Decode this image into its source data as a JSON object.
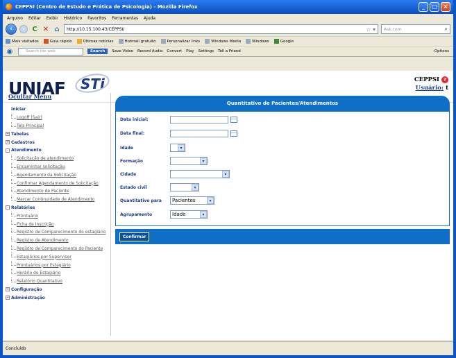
{
  "window": {
    "title": "CEPPSI (Centro de Estudo e Prática de Psicologia) - Mozilla Firefox"
  },
  "menubar": [
    "Arquivo",
    "Editar",
    "Exibir",
    "Histórico",
    "Favoritos",
    "Ferramentas",
    "Ajuda"
  ],
  "nav": {
    "url": "http://10.15.100.43/CEPPSI/",
    "search_placeholder": "Ask.com"
  },
  "bookmarks": [
    "Mais visitados",
    "Guia rápido",
    "Últimas notícias",
    "Hotmail gratuito",
    "Personalizar links",
    "Windows Media",
    "Windows",
    "Google"
  ],
  "toolbar2": {
    "search_placeholder": "Search the web",
    "search_button": "Search",
    "items": [
      "Save Video",
      "Record Audio",
      "Convert",
      "Play",
      "Settings",
      "Tell a Friend"
    ],
    "options": "Options"
  },
  "header": {
    "logo_main": "UNIAF",
    "logo_sti": "STi",
    "org": "CEPPSI",
    "user_label": "Usuário:",
    "user_value": "t"
  },
  "sidebar": {
    "title": "Ocultar Menu",
    "tree": [
      {
        "type": "group",
        "label": "Iniciar",
        "box": ""
      },
      {
        "type": "leaf",
        "label": "Logoff (Sair)"
      },
      {
        "type": "leaf",
        "label": "Tela Principal"
      },
      {
        "type": "group",
        "label": "Tabelas",
        "box": "+"
      },
      {
        "type": "group",
        "label": "Cadastros",
        "box": "+"
      },
      {
        "type": "group",
        "label": "Atendimento",
        "box": "-"
      },
      {
        "type": "leaf",
        "label": "Solicitação de atendimento"
      },
      {
        "type": "leaf",
        "label": "Encaminhar solicitação"
      },
      {
        "type": "leaf",
        "label": "Agendamento da Solicitação"
      },
      {
        "type": "leaf",
        "label": "Confirmar Agendamento de Solicitação"
      },
      {
        "type": "leaf",
        "label": "Atendimento de Paciente"
      },
      {
        "type": "leaf",
        "label": "Marcar Continuidade de Atendimento"
      },
      {
        "type": "group",
        "label": "Relatórios",
        "box": "-"
      },
      {
        "type": "leaf",
        "label": "Prontuário"
      },
      {
        "type": "leaf",
        "label": "Ficha de Inscrição"
      },
      {
        "type": "leaf",
        "label": "Registro de Comparecimento do estagiário"
      },
      {
        "type": "leaf",
        "label": "Registro de Atendimento"
      },
      {
        "type": "leaf",
        "label": "Registro de Comparecimento do Paciente"
      },
      {
        "type": "leaf",
        "label": "Estagiários por Supervisor"
      },
      {
        "type": "leaf",
        "label": "Prontuários por Estagiário"
      },
      {
        "type": "leaf",
        "label": "Horário do Estagiário"
      },
      {
        "type": "leaf",
        "label": "Relatório Quantitativo"
      },
      {
        "type": "group",
        "label": "Configuração",
        "box": "+"
      },
      {
        "type": "group",
        "label": "Administração",
        "box": "+"
      }
    ]
  },
  "form": {
    "title": "Quantitativo de Pacientes/Atendimentos",
    "fields": [
      {
        "label": "Data inicial:",
        "kind": "date",
        "value": ""
      },
      {
        "label": "Data final:",
        "kind": "date",
        "value": ""
      },
      {
        "label": "Idade",
        "kind": "select",
        "value": ""
      },
      {
        "label": "Formação",
        "kind": "select",
        "value": ""
      },
      {
        "label": "Cidade",
        "kind": "select",
        "value": ""
      },
      {
        "label": "Estado civil",
        "kind": "select",
        "value": ""
      },
      {
        "label": "Quantitativo para",
        "kind": "select",
        "value": "Pacientes"
      },
      {
        "label": "Agrupamento",
        "kind": "select",
        "value": "Idade"
      }
    ],
    "confirm": "Confirmar"
  },
  "status": "Concluído"
}
